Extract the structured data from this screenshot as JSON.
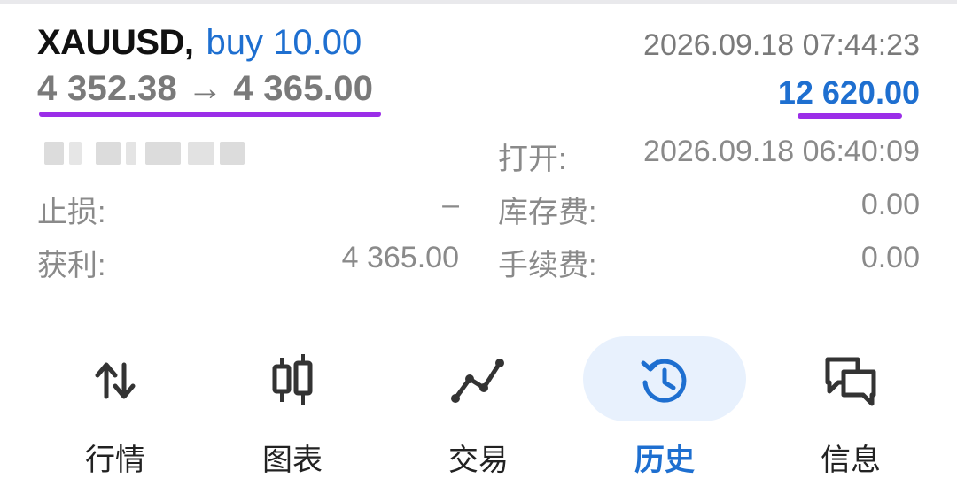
{
  "deal": {
    "symbol": "XAUUSD,",
    "side_volume": "buy 10.00",
    "prices": "4 352.38 → 4 365.00",
    "close_time": "2026.09.18 07:44:23",
    "profit_total": "12 620.00"
  },
  "details": {
    "open_label": "打开:",
    "open_time": "2026.09.18 06:40:09",
    "sl_label": "止损:",
    "sl_value": "–",
    "swap_label": "库存费:",
    "swap_value": "0.00",
    "tp_label": "获利:",
    "tp_value": "4 365.00",
    "fee_label": "手续费:",
    "fee_value": "0.00"
  },
  "nav": {
    "items": [
      {
        "label": "行情",
        "icon": "arrows-updown-icon",
        "active": false
      },
      {
        "label": "图表",
        "icon": "candlestick-icon",
        "active": false
      },
      {
        "label": "交易",
        "icon": "trend-line-icon",
        "active": false
      },
      {
        "label": "历史",
        "icon": "history-clock-icon",
        "active": true
      },
      {
        "label": "信息",
        "icon": "chat-bubbles-icon",
        "active": false
      }
    ]
  },
  "colors": {
    "accent_blue": "#1e6fd0",
    "underline_purple": "#9b2ee8",
    "active_pill": "#e8f1fd",
    "muted_text": "#8a8a8a"
  }
}
